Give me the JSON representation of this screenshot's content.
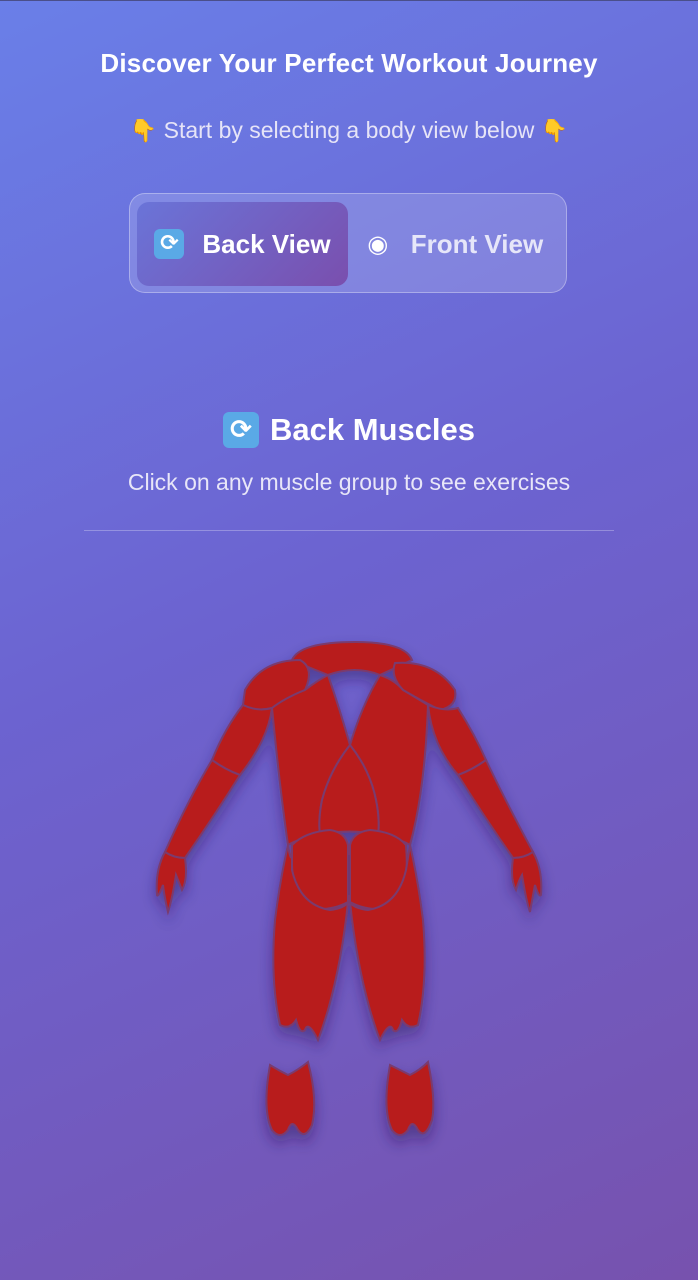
{
  "header": {
    "title": "Discover Your Perfect Workout Journey",
    "subtitle": "Start by selecting a body view below",
    "hand_icon": "pointing-down-hand-icon"
  },
  "view_toggle": {
    "back": {
      "label": "Back View",
      "icon": "cycle-arrows-icon",
      "active": true
    },
    "front": {
      "label": "Front View",
      "icon": "eye-icon",
      "active": false
    }
  },
  "section": {
    "title": "Back Muscles",
    "icon": "cycle-arrows-icon",
    "instruction": "Click on any muscle group to see exercises"
  },
  "muscle_groups": [
    "trapezius",
    "deltoids",
    "triceps",
    "forearms",
    "latissimus-dorsi",
    "lower-back",
    "glutes",
    "hamstrings",
    "calves"
  ],
  "colors": {
    "muscle": "#b81e1e",
    "background_start": "#6a7fe8",
    "background_end": "#7752ae",
    "active_tab": "#7a4fae"
  }
}
